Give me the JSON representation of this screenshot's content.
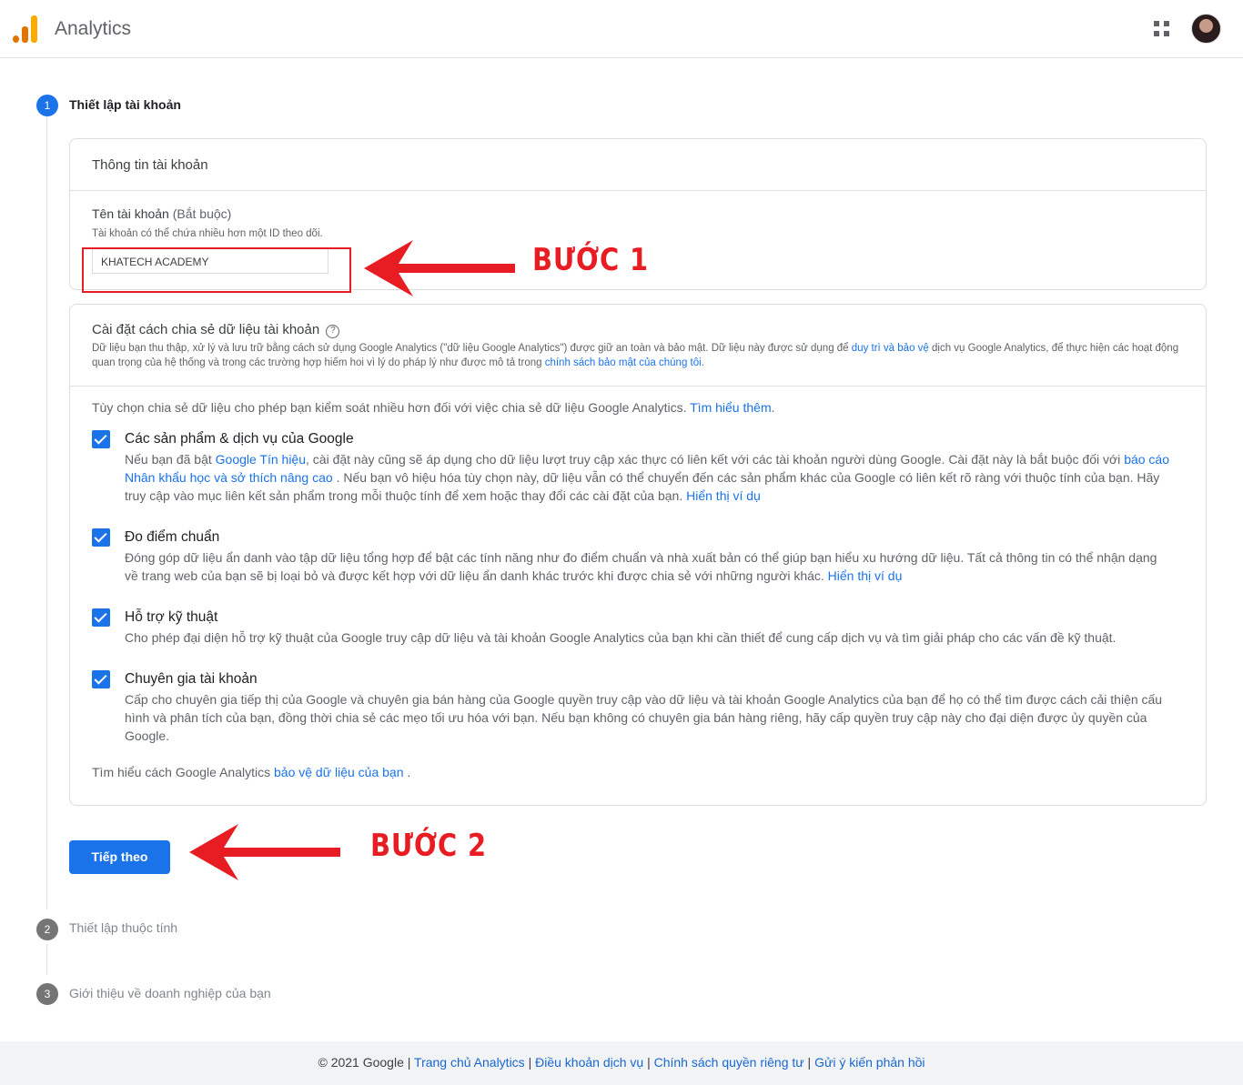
{
  "header": {
    "app_title": "Analytics",
    "apps_icon": "apps-grid-icon",
    "avatar_icon": "user-avatar"
  },
  "steps": [
    {
      "number": "1",
      "label": "Thiết lập tài khoản",
      "active": true
    },
    {
      "number": "2",
      "label": "Thiết lập thuộc tính",
      "active": false
    },
    {
      "number": "3",
      "label": "Giới thiệu về doanh nghiệp của bạn",
      "active": false
    }
  ],
  "account_card": {
    "title": "Thông tin tài khoản",
    "field_label": "Tên tài khoản",
    "field_required": "(Bắt buộc)",
    "field_hint": "Tài khoản có thể chứa nhiều hơn một ID theo dõi.",
    "field_value": "KHATECH ACADEMY"
  },
  "sharing_card": {
    "title": "Cài đặt cách chia sẻ dữ liệu tài khoản",
    "desc_part1": "Dữ liệu bạn thu thập, xử lý và lưu trữ bằng cách sử dụng Google Analytics (\"dữ liệu Google Analytics\") được giữ an toàn và bảo mật. Dữ liệu này được sử dụng để ",
    "desc_link1": "duy trì và bảo vệ",
    "desc_part2": " dịch vụ Google Analytics, để thực hiện các hoạt động quan trọng của hệ thống và trong các trường hợp hiếm hoi vì lý do pháp lý như được mô tả trong ",
    "desc_link2": "chính sách bảo mật của chúng tôi",
    "desc_part3": ".",
    "intro": "Tùy chọn chia sẻ dữ liệu cho phép bạn kiểm soát nhiều hơn đối với việc chia sẻ dữ liệu Google Analytics. ",
    "intro_link": "Tìm hiểu thêm",
    "intro_end": ".",
    "options": [
      {
        "title": "Các sản phẩm & dịch vụ của Google",
        "d1": "Nếu bạn đã bật ",
        "l1": "Google Tín hiệu",
        "d2": ", cài đặt này cũng sẽ áp dụng cho dữ liệu lượt truy cập xác thực có liên kết với các tài khoản người dùng Google. Cài đặt này là bắt buộc đối với ",
        "l2": "báo cáo Nhân khẩu học và sở thích nâng cao",
        "d3": " . Nếu bạn vô hiệu hóa tùy chọn này, dữ liệu vẫn có thể chuyển đến các sản phẩm khác của Google có liên kết rõ ràng với thuộc tính của bạn. Hãy truy cập vào mục liên kết sản phẩm trong mỗi thuộc tính để xem hoặc thay đổi các cài đặt của bạn.  ",
        "l3": "Hiển thị ví dụ"
      },
      {
        "title": "Đo điểm chuẩn",
        "d1": "Đóng góp dữ liệu ẩn danh vào tập dữ liệu tổng hợp để bật các tính năng như đo điểm chuẩn và nhà xuất bản có thể giúp bạn hiểu xu hướng dữ liệu. Tất cả thông tin có thể nhận dạng về trang web của bạn sẽ bị loại bỏ và được kết hợp với dữ liệu ẩn danh khác trước khi được chia sẻ với những người khác.  ",
        "l1": "Hiển thị ví dụ"
      },
      {
        "title": "Hỗ trợ kỹ thuật",
        "d1": "Cho phép đại diện hỗ trợ kỹ thuật của Google truy cập dữ liệu và tài khoản Google Analytics của bạn khi cần thiết để cung cấp dịch vụ và tìm giải pháp cho các vấn đề kỹ thuật."
      },
      {
        "title": "Chuyên gia tài khoản",
        "d1": "Cấp cho chuyên gia tiếp thị của Google và chuyên gia bán hàng của Google quyền truy cập vào dữ liệu và tài khoản Google Analytics của bạn để họ có thể tìm được cách cải thiện cấu hình và phân tích của bạn, đồng thời chia sẻ các mẹo tối ưu hóa với bạn. Nếu bạn không có chuyên gia bán hàng riêng, hãy cấp quyền truy cập này cho đại diện được ủy quyền của Google."
      }
    ],
    "learn_prefix": "Tìm hiểu cách Google Analytics ",
    "learn_link": "bảo vệ dữ liệu của bạn",
    "learn_end": " ."
  },
  "next_button": "Tiếp theo",
  "annotations": {
    "step1": "BƯỚC 1",
    "step2": "BƯỚC 2",
    "color": "#e81c23"
  },
  "footer": {
    "copyright": "© 2021 Google | ",
    "links": [
      "Trang chủ Analytics",
      "Điều khoản dịch vụ",
      "Chính sách quyền riêng tư",
      "Gửi ý kiến phản hồi"
    ],
    "sep": " | "
  },
  "colors": {
    "primary": "#1a73e8",
    "annotation": "#e81c23"
  }
}
